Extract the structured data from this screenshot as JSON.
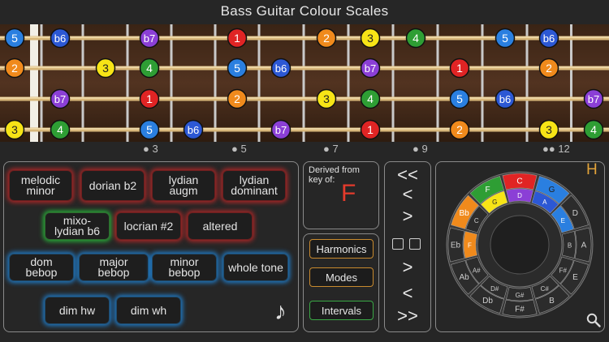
{
  "title": "Bass Guitar Colour Scales",
  "fret_markers": [
    "3",
    "5",
    "7",
    "9",
    "12"
  ],
  "strings": [
    [
      {
        "fret": 0,
        "label": "5"
      },
      {
        "fret": 1,
        "label": "b6"
      },
      {
        "fret": 3,
        "label": "b7"
      },
      {
        "fret": 5,
        "label": "1"
      },
      {
        "fret": 7,
        "label": "2"
      },
      {
        "fret": 8,
        "label": "3"
      },
      {
        "fret": 9,
        "label": "4"
      },
      {
        "fret": 11,
        "label": "5"
      },
      {
        "fret": 12,
        "label": "b6"
      }
    ],
    [
      {
        "fret": 0,
        "label": "2"
      },
      {
        "fret": 2,
        "label": "3"
      },
      {
        "fret": 3,
        "label": "4"
      },
      {
        "fret": 5,
        "label": "5"
      },
      {
        "fret": 6,
        "label": "b6"
      },
      {
        "fret": 8,
        "label": "b7"
      },
      {
        "fret": 10,
        "label": "1"
      },
      {
        "fret": 12,
        "label": "2"
      }
    ],
    [
      {
        "fret": 1,
        "label": "b7"
      },
      {
        "fret": 3,
        "label": "1"
      },
      {
        "fret": 5,
        "label": "2"
      },
      {
        "fret": 7,
        "label": "3"
      },
      {
        "fret": 8,
        "label": "4"
      },
      {
        "fret": 10,
        "label": "5"
      },
      {
        "fret": 11,
        "label": "b6"
      },
      {
        "fret": 13,
        "label": "b7"
      }
    ],
    [
      {
        "fret": 0,
        "label": "3"
      },
      {
        "fret": 1,
        "label": "4"
      },
      {
        "fret": 3,
        "label": "5"
      },
      {
        "fret": 4,
        "label": "b6"
      },
      {
        "fret": 6,
        "label": "b7"
      },
      {
        "fret": 8,
        "label": "1"
      },
      {
        "fret": 10,
        "label": "2"
      },
      {
        "fret": 12,
        "label": "3"
      },
      {
        "fret": 13,
        "label": "4"
      }
    ]
  ],
  "degree_colors": {
    "1": "#e02424",
    "2": "#f08a1c",
    "3": "#f7e416",
    "4": "#2e9e34",
    "5": "#2a7fe0",
    "b6": "#2c58d4",
    "b7": "#8b3fd6"
  },
  "scales": {
    "melodic_minor": "melodic\nminor",
    "dorian_b2": "dorian b2",
    "lydian_augm": "lydian augm",
    "lydian_dominant": "lydian\ndominant",
    "mixo_lydian_b6": "mixo-\nlydian b6",
    "locrian_2": "locrian #2",
    "altered": "altered",
    "dom_bebop": "dom bebop",
    "major_bebop": "major bebop",
    "minor_bebop": "minor bebop",
    "whole_tone": "whole tone",
    "dim_hw": "dim hw",
    "dim_wh": "dim wh"
  },
  "derived": {
    "label": "Derived from key of:",
    "key": "F"
  },
  "side_buttons": {
    "harmonics": "Harmonics",
    "modes": "Modes",
    "intervals": "Intervals"
  },
  "nav": {
    "first": "<<",
    "prev": "<",
    "next": ">",
    "next2": ">",
    "prev2": "<",
    "last": ">>"
  },
  "icons": {
    "music": "music-note-icon",
    "search": "search-icon",
    "help": "H"
  },
  "circle": {
    "outer": [
      "C",
      "G",
      "D",
      "A",
      "E",
      "B",
      "F#",
      "Db",
      "Ab",
      "Eb",
      "Bb",
      "F"
    ],
    "outer_colors": {
      "C": "#e02424",
      "G": "#2a7fe0",
      "D": "",
      "A": "",
      "E": "",
      "B": "",
      "F#": "",
      "Db": "",
      "Ab": "",
      "Eb": "",
      "Bb": "#f08a1c",
      "F": "#2e9e34"
    },
    "inner": [
      "D",
      "A",
      "E",
      "B",
      "F#",
      "C#",
      "G#",
      "D#",
      "A#",
      "F",
      "C",
      "G"
    ],
    "inner_colors": {
      "D": "#8b3fd6",
      "A": "#2c58d4",
      "E": "#2a7fe0",
      "B": "",
      "F#": "",
      "C#": "",
      "G#": "",
      "D#": "",
      "A#": "",
      "F": "#f08a1c",
      "C": "",
      "G": "#f7e416"
    },
    "alt_labels": [
      "Gb F#",
      "Db C#",
      "Cb",
      "C# Db"
    ]
  }
}
